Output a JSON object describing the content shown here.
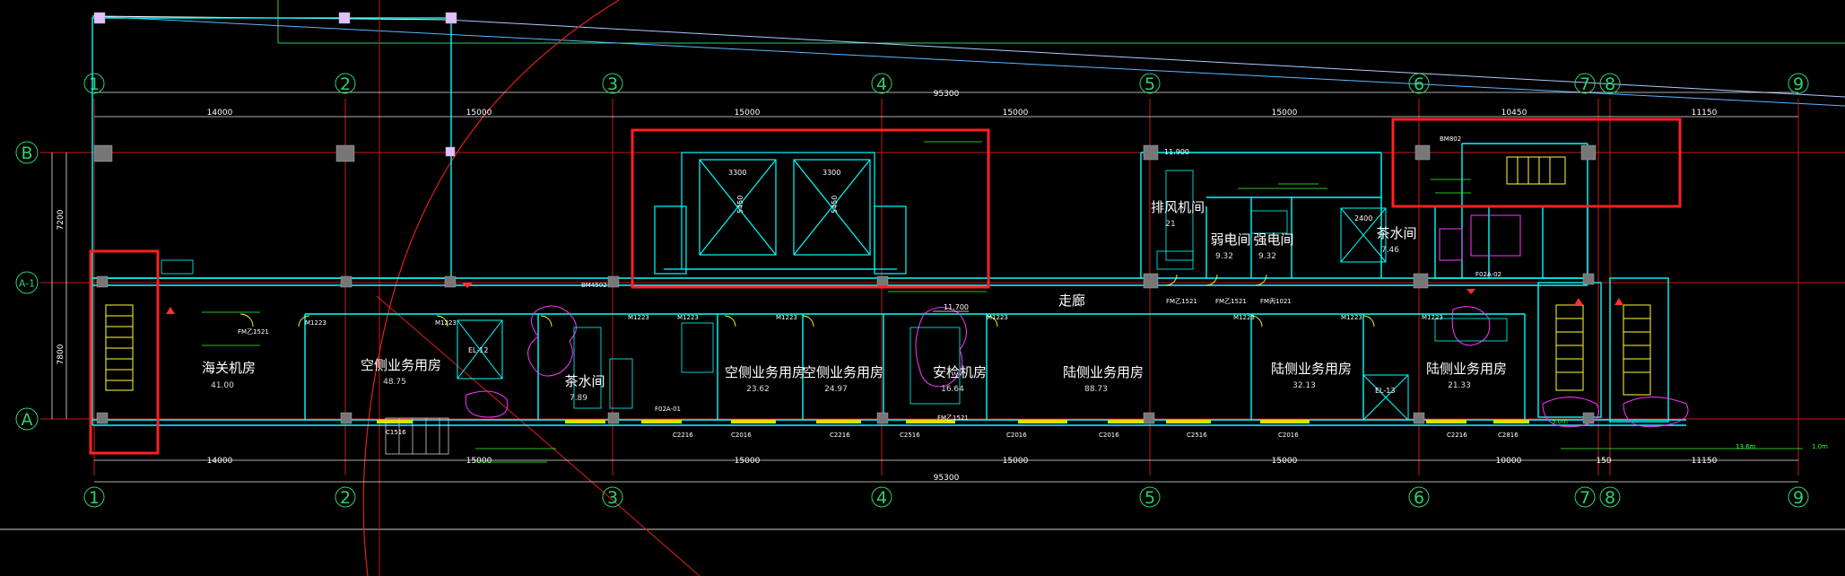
{
  "grid_labels_top": [
    "1",
    "2",
    "3",
    "4",
    "5",
    "6",
    "7",
    "8",
    "9"
  ],
  "grid_labels_left": [
    "B",
    "A-1",
    "A"
  ],
  "dimensions": {
    "overall": "95300",
    "bay_1_2": "14000",
    "bay_2_3": "15000",
    "bay_3_4": "15000",
    "bay_4_5": "15000",
    "bay_5_6": "15000",
    "bay_6_7_top": "10450",
    "bay_8_9": "11150",
    "bay_6_7_bottom": "10000",
    "bay_7_8_bottom": "150",
    "left_1": "7200",
    "left_2": "7800"
  },
  "rooms": [
    {
      "name": "海关机房",
      "area": "41.00"
    },
    {
      "name": "空侧业务用房",
      "area": "48.75"
    },
    {
      "name": "茶水间",
      "area": "7.89"
    },
    {
      "name": "空侧业务用房",
      "area": "23.62"
    },
    {
      "name": "空侧业务用房",
      "area": "24.97"
    },
    {
      "name": "安检机房",
      "area": "16.64"
    },
    {
      "name": "陆侧业务用房",
      "area": "88.73"
    },
    {
      "name": "陆侧业务用房",
      "area": "32.13"
    },
    {
      "name": "陆侧业务用房",
      "area": "21.33"
    },
    {
      "name": "排风机间",
      "area": "21"
    },
    {
      "name": "弱电间",
      "area": "9.32"
    },
    {
      "name": "强电间",
      "area": "9.32"
    },
    {
      "name": "茶水间",
      "area": "7.46"
    }
  ],
  "corridor_label": "走廊",
  "elevator_dims": [
    "3300",
    "3300"
  ],
  "elevator_depth": "5450",
  "elevator_tags": [
    "EL-12",
    "EL-13"
  ],
  "level_mark": "11.700",
  "level_mark_right": "11.900",
  "lift_2400": "2400",
  "door_tags": [
    "M1223",
    "M1223",
    "M1223",
    "M1223",
    "M1223",
    "M1223",
    "M1223",
    "M1223",
    "M1223"
  ],
  "window_tags": [
    "C1516",
    "C2216",
    "C2016",
    "C2216",
    "C2516",
    "C2016",
    "C2016",
    "C2516",
    "C2016",
    "C2216",
    "C2816"
  ],
  "zone_tags": [
    "F02A-01",
    "F02A-02"
  ],
  "fire_tags": [
    "FM乙1521",
    "FM乙1521",
    "FM乙1521",
    "FM丙1021",
    "FM乙1521"
  ],
  "misc_tags": [
    "BM802",
    "BM4502",
    "13.6m",
    "5.0m",
    "1.0m"
  ],
  "highlight_color": "#ff2020",
  "cad_colors": {
    "wall": "#00ffff",
    "grid": "#d11a1a",
    "dim": "#e8e8e8",
    "tag": "#ffff00",
    "note": "#33ff33",
    "furniture": "#ff33ff"
  }
}
